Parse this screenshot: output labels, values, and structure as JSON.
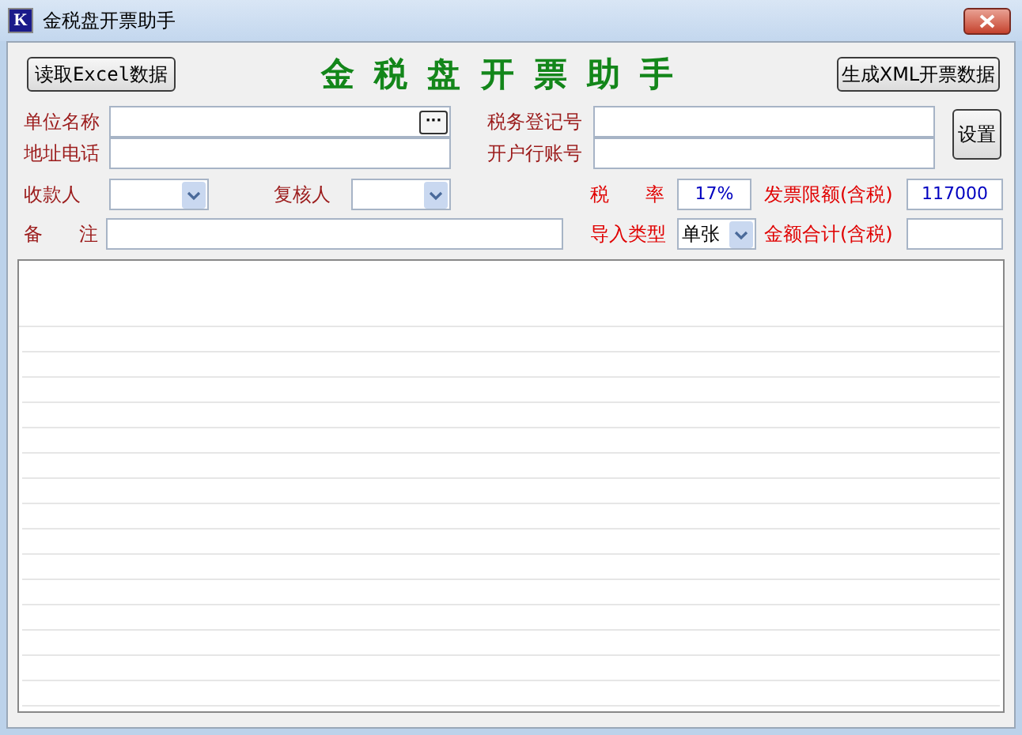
{
  "window": {
    "title": "金税盘开票助手",
    "icon_letter": "K"
  },
  "toolbar": {
    "import_button": "读取Excel数据",
    "heading": "金税盘开票助手",
    "export_button": "生成XML开票数据"
  },
  "company": {
    "name_label": "单位名称",
    "browse_button": "···",
    "address_label": "地址电话",
    "tax_id_label": "税务登记号",
    "bank_label": "开户行账号",
    "settings_button": "设置"
  },
  "row3": {
    "payee_label": "收款人",
    "reviewer_label": "复核人",
    "tax_rate_label": "税 率",
    "tax_rate": "17%",
    "limit_label": "发票限额(含税)",
    "limit": "117000"
  },
  "row4": {
    "note_label": "备 注",
    "import_type_label": "导入类型",
    "import_type": "单张",
    "total_label": "金额合计(含税)"
  }
}
